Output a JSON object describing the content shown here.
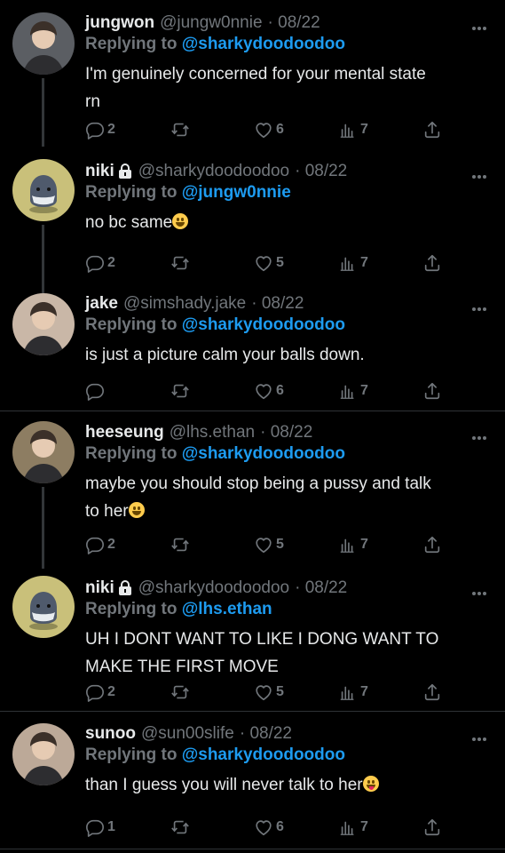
{
  "tweets": [
    {
      "name": "jungwon",
      "handle": "@jungw0nnie",
      "date": "· 08/22",
      "locked": false,
      "replying_prefix": "Replying to",
      "replying_to": "@sharkydoodoodoo",
      "lines": [
        "I'm genuinely concerned for your mental state",
        "rn"
      ],
      "emoji": "",
      "replies": "2",
      "retweets": "",
      "likes": "6",
      "views": "7",
      "avatar": "person-avatar",
      "avatar_color": "#5b5e63"
    },
    {
      "name": "niki",
      "handle": "@sharkydoodoodoo",
      "date": "· 08/22",
      "locked": true,
      "replying_prefix": "Replying to",
      "replying_to": "@jungw0nnie",
      "lines": [
        "no bc same"
      ],
      "emoji": "grin",
      "replies": "2",
      "retweets": "",
      "likes": "5",
      "views": "7",
      "avatar": "shark-avatar",
      "avatar_color": "#c9c07a"
    },
    {
      "name": "jake",
      "handle": "@simshady.jake",
      "date": "· 08/22",
      "locked": false,
      "replying_prefix": "Replying to",
      "replying_to": "@sharkydoodoodoo",
      "lines": [
        "is just a picture calm your balls down."
      ],
      "emoji": "",
      "replies": "",
      "retweets": "",
      "likes": "6",
      "views": "7",
      "avatar": "person-avatar",
      "avatar_color": "#c9b7a7"
    },
    {
      "name": "heeseung",
      "handle": "@lhs.ethan",
      "date": "· 08/22",
      "locked": false,
      "replying_prefix": "Replying to",
      "replying_to": "@sharkydoodoodoo",
      "lines": [
        "maybe you should stop being a pussy and talk",
        "to her"
      ],
      "emoji": "laugh",
      "replies": "2",
      "retweets": "",
      "likes": "5",
      "views": "7",
      "avatar": "person-avatar",
      "avatar_color": "#8d7d62"
    },
    {
      "name": "niki",
      "handle": "@sharkydoodoodoo",
      "date": "· 08/22",
      "locked": true,
      "replying_prefix": "Replying to",
      "replying_to": "@lhs.ethan",
      "lines": [
        "UH I DONT WANT TO LIKE I DONG WANT TO",
        "MAKE THE FIRST MOVE"
      ],
      "emoji": "",
      "replies": "2",
      "retweets": "",
      "likes": "5",
      "views": "7",
      "avatar": "shark-avatar",
      "avatar_color": "#c9c07a"
    },
    {
      "name": "sunoo",
      "handle": "@sun00slife",
      "date": "· 08/22",
      "locked": false,
      "replying_prefix": "Replying to",
      "replying_to": "@sharkydoodoodoo",
      "lines": [
        "than I guess you will never talk to her"
      ],
      "emoji": "tongue",
      "replies": "1",
      "retweets": "",
      "likes": "6",
      "views": "7",
      "avatar": "person-avatar",
      "avatar_color": "#bca998"
    }
  ],
  "colors": {
    "background": "#000000",
    "text": "#e7e9ea",
    "muted": "#71767b",
    "link": "#1d9bf0"
  }
}
